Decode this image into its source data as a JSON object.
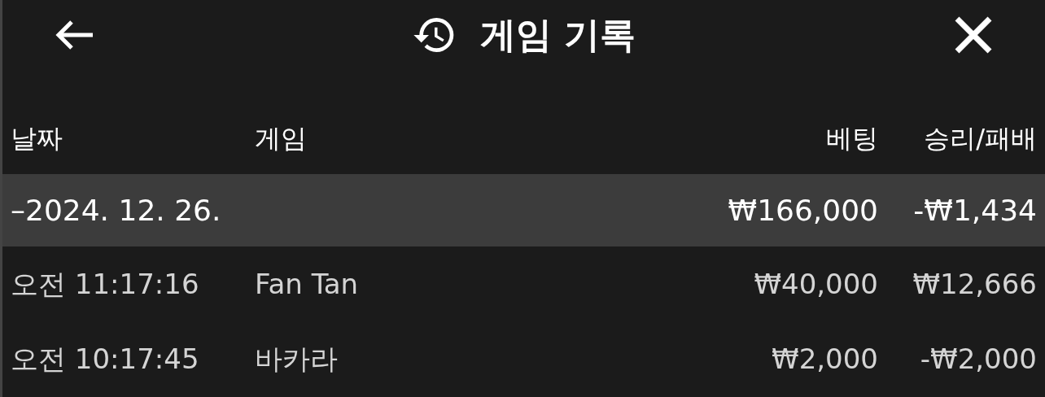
{
  "header": {
    "title": "게임 기록"
  },
  "table": {
    "columns": [
      "날짜",
      "게임",
      "베팅",
      "승리/패배"
    ],
    "groups": [
      {
        "date": "–2024. 12. 26.",
        "bet": "₩166,000",
        "result": "-₩1,434",
        "rows": [
          {
            "time": "오전 11:17:16",
            "game": "Fan Tan",
            "bet": "₩40,000",
            "result": "₩12,666"
          },
          {
            "time": "오전 10:17:45",
            "game": "바카라",
            "bet": "₩2,000",
            "result": "-₩2,000"
          }
        ]
      }
    ]
  }
}
